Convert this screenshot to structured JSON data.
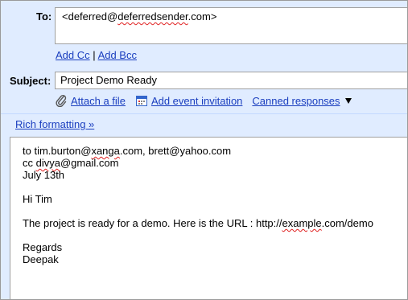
{
  "to": {
    "label": "To:",
    "value_prefix": "<deferred@",
    "value_domain": "deferredsender",
    "value_suffix": ".com>"
  },
  "recipients_links": {
    "add_cc": "Add Cc",
    "separator": "|",
    "add_bcc": "Add Bcc"
  },
  "subject": {
    "label": "Subject:",
    "value": "Project Demo Ready"
  },
  "toolbar": {
    "attach_file": "Attach a file",
    "add_event": "Add event invitation",
    "canned_responses": "Canned responses"
  },
  "rich_formatting": "Rich formatting »",
  "body": {
    "line1_a": "to tim.burton@",
    "line1_b": "xanga",
    "line1_c": ".com, brett@yahoo.com",
    "line2_a": "cc ",
    "line2_b": "divya",
    "line2_c": "@gmail.com",
    "line3": "July 13th",
    "greeting": "Hi Tim",
    "text_a": "The project is ready for a demo. Here is the URL : http://",
    "text_b": "example",
    "text_c": ".com/demo",
    "signoff": "Regards",
    "signature": "Deepak"
  },
  "colors": {
    "panel_bg": "#e0ecff",
    "link": "#1a3ebf",
    "spell_error": "#e02020"
  },
  "icons": {
    "attach": "paperclip-icon",
    "event": "calendar-icon",
    "dropdown": "chevron-down-icon"
  }
}
